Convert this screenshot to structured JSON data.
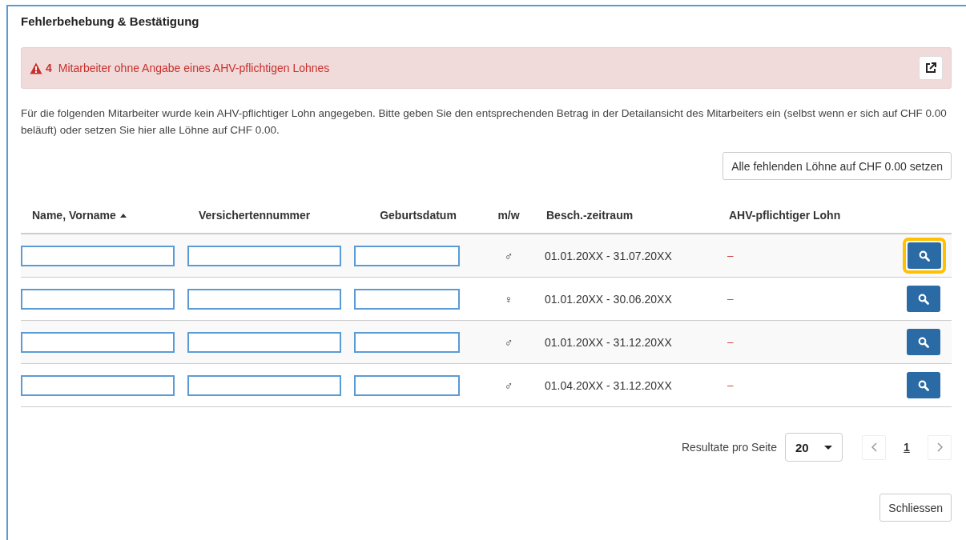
{
  "title": "Fehlerbehebung & Bestätigung",
  "alert": {
    "count": "4",
    "message": "Mitarbeiter ohne Angabe eines AHV-pflichtigen Lohnes"
  },
  "description": "Für die folgenden Mitarbeiter wurde kein AHV-pflichtiger Lohn angegeben. Bitte geben Sie den entsprechenden Betrag in der Detailansicht des Mitarbeiters ein (selbst wenn er sich auf CHF 0.00 beläuft) oder setzen Sie hier alle Löhne auf CHF 0.00.",
  "set_all_button": "Alle fehlenden Löhne auf CHF 0.00 setzen",
  "table": {
    "columns": [
      {
        "label": "Name, Vorname",
        "sorted": true
      },
      {
        "label": "Versichertennummer",
        "sorted": false
      },
      {
        "label": "Geburtsdatum",
        "sorted": false
      },
      {
        "label": "m/w",
        "sorted": false
      },
      {
        "label": "Besch.-zeitraum",
        "sorted": false
      },
      {
        "label": "AHV-pflichtiger Lohn",
        "sorted": false
      }
    ],
    "rows": [
      {
        "gender": "♂",
        "period": "01.01.20XX - 31.07.20XX",
        "salary": "–",
        "highlighted": true
      },
      {
        "gender": "♀",
        "period": "01.01.20XX - 30.06.20XX",
        "salary": "–",
        "highlighted": false
      },
      {
        "gender": "♂",
        "period": "01.01.20XX - 31.12.20XX",
        "salary": "–",
        "highlighted": false
      },
      {
        "gender": "♂",
        "period": "01.04.20XX - 31.12.20XX",
        "salary": "–",
        "highlighted": false
      }
    ]
  },
  "pagination": {
    "label": "Resultate pro Seite",
    "page_size": "20",
    "pages": [
      {
        "label": "1",
        "selected": true
      }
    ]
  },
  "close_button": "Schliessen"
}
